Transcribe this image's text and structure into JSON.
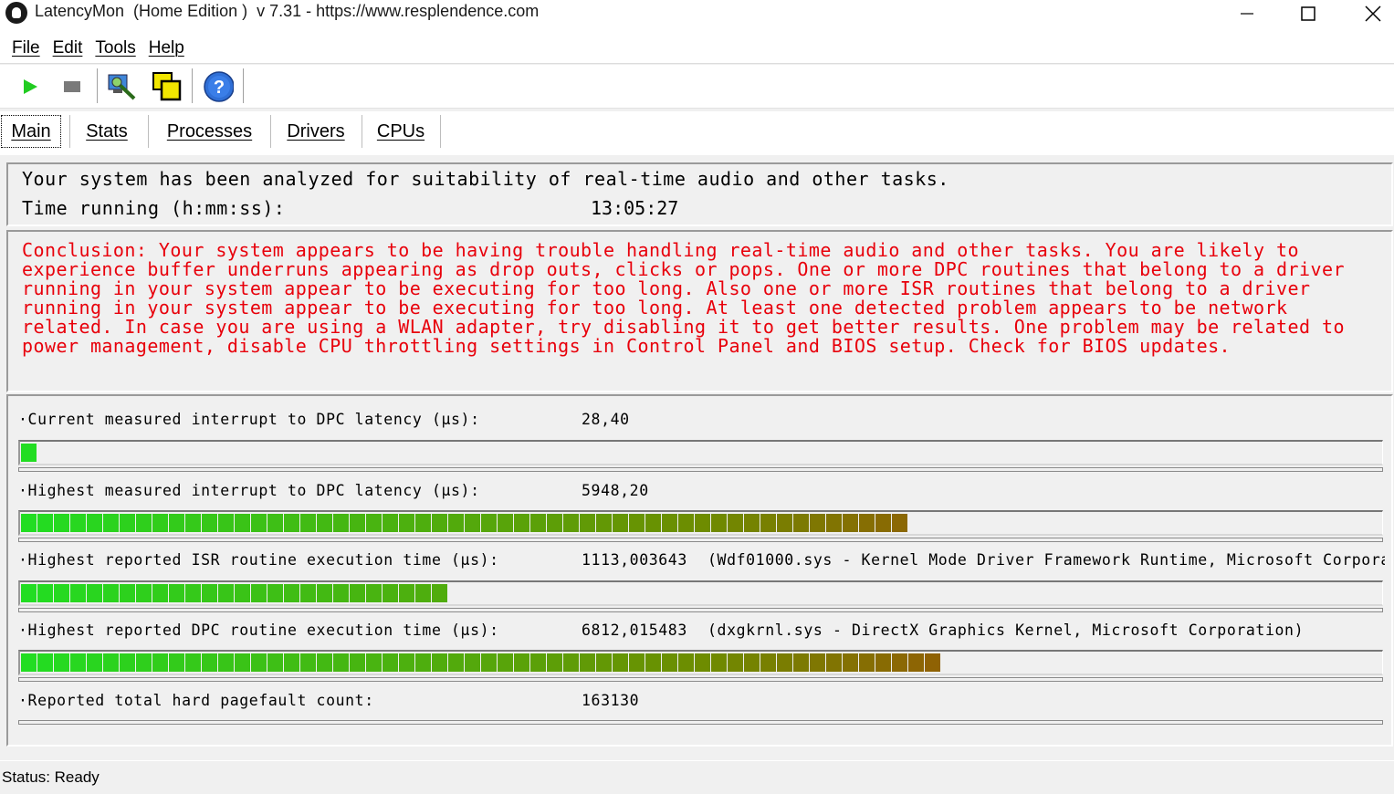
{
  "window": {
    "title": "LatencyMon  (Home Edition )  v 7.31 - https://www.resplendence.com"
  },
  "menu": [
    "File",
    "Edit",
    "Tools",
    "Help"
  ],
  "toolbar": {
    "icons": [
      "play-icon",
      "stop-icon",
      "inspect-icon",
      "copy-window-icon",
      "help-icon"
    ]
  },
  "tabs": [
    "Main",
    "Stats",
    "Processes",
    "Drivers",
    "CPUs"
  ],
  "summary": {
    "line1": "Your system has been analyzed for suitability of real-time audio and other tasks.",
    "time_label": "Time running (h:mm:ss):",
    "time_value": "13:05:27"
  },
  "conclusion": "Conclusion: Your system appears to be having trouble handling real-time audio and other tasks. You are likely to experience buffer underruns appearing as drop outs, clicks or pops. One or more DPC routines that belong to a driver running in your system appear to be executing for too long. Also one or more ISR routines that belong to a driver running in your system appear to be executing for too long. At least one detected problem appears to be network related. In case you are using a WLAN adapter, try disabling it to get better results. One problem may be related to power management, disable CPU throttling settings in Control Panel and BIOS setup. Check for BIOS updates.",
  "metrics": [
    {
      "label": "·Current measured interrupt to DPC latency (µs):",
      "value": "28,40",
      "desc": "",
      "level": 0.011
    },
    {
      "label": "·Highest measured interrupt to DPC latency (µs):",
      "value": "5948,20",
      "desc": "",
      "level": 0.662
    },
    {
      "label": "·Highest reported ISR routine execution time (µs):",
      "value": "1113,003643",
      "desc": "(Wdf01000.sys - Kernel Mode Driver Framework Runtime, Microsoft Corpora",
      "level": 0.312
    },
    {
      "label": "·Highest reported DPC routine execution time (µs):",
      "value": "6812,015483",
      "desc": "(dxgkrnl.sys - DirectX Graphics Kernel, Microsoft Corporation)",
      "level": 0.686
    },
    {
      "label": "·Reported total hard pagefault count:",
      "value": "163130",
      "desc": "",
      "level": null
    }
  ],
  "status": "Status: Ready",
  "colors": {
    "conclusion_text": "#e8000b",
    "bar_green": "#22dd22",
    "bar_red": "#d0100c"
  }
}
